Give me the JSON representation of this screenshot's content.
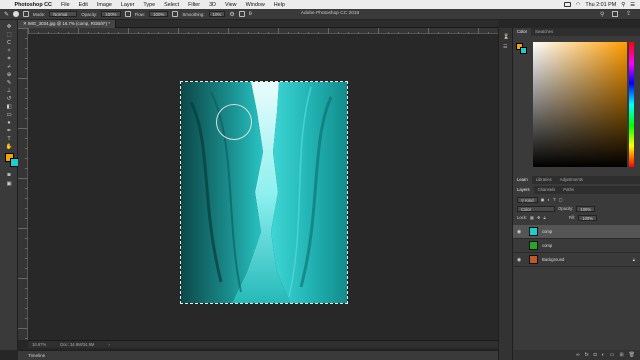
{
  "menubar": {
    "app_name": "Photoshop CC",
    "items": [
      "File",
      "Edit",
      "Image",
      "Layer",
      "Type",
      "Select",
      "Filter",
      "3D",
      "View",
      "Window",
      "Help"
    ],
    "clock": "Thu 2:01 PM"
  },
  "window_title": "Adobe Photoshop CC 2018",
  "options": {
    "mode_label": "Mode:",
    "mode_value": "Normal",
    "opacity_label": "Opacity:",
    "opacity_value": "100%",
    "flow_label": "Flow:",
    "flow_value": "100%",
    "smoothing_label": "Smoothing:",
    "smoothing_value": "10%"
  },
  "document_tab": "IMG_3034.jpg @ 16.7% (comp, RGB/8*) *",
  "status": {
    "zoom": "16.67%",
    "doc_size": "Doc: 34.9M/34.9M"
  },
  "timeline_label": "Timeline",
  "color_panel": {
    "tabs": [
      "Color",
      "Swatches"
    ],
    "fg_color": "#f5a300",
    "bg_color": "#1ccfcf"
  },
  "mid_panel_tabs": [
    "Learn",
    "Libraries",
    "Adjustments"
  ],
  "layers_panel": {
    "tabs": [
      "Layers",
      "Channels",
      "Paths"
    ],
    "filter_label": "Kind",
    "blend_mode": "Color",
    "opacity_label": "Opacity:",
    "opacity_value": "100%",
    "lock_label": "Lock:",
    "fill_label": "Fill:",
    "fill_value": "100%",
    "layers": [
      {
        "name": "comp",
        "thumb_color": "#1ccfcf",
        "visible": true,
        "selected": true
      },
      {
        "name": "comp",
        "thumb_color": "#2aa52a",
        "visible": false,
        "selected": false
      },
      {
        "name": "Background",
        "thumb_color": "#c0582a",
        "visible": true,
        "selected": false
      }
    ]
  }
}
